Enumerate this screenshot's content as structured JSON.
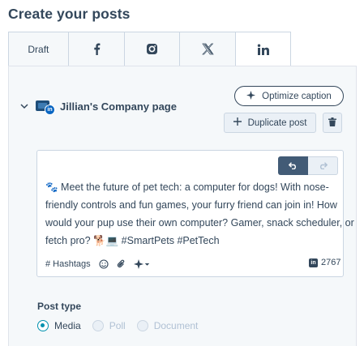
{
  "page": {
    "title": "Create your posts"
  },
  "tabs": [
    {
      "label": "Draft",
      "icon": ""
    },
    {
      "label": "",
      "icon": "facebook-icon"
    },
    {
      "label": "",
      "icon": "instagram-icon"
    },
    {
      "label": "",
      "icon": "x-icon"
    },
    {
      "label": "",
      "icon": "linkedin-icon",
      "active": true
    }
  ],
  "account": {
    "name": "Jillian's Company page",
    "badge": "in"
  },
  "actions": {
    "optimize_label": "Optimize caption",
    "duplicate_label": "Duplicate post"
  },
  "post": {
    "text_lines": [
      "🐾 Meet the future of pet tech: a computer for dogs! With nose-",
      "friendly controls and fun games, your furry friend can join in! How",
      "would your pup use their own computer? Gamer, snack scheduler, or",
      "fetch pro? 🐕💻 #SmartPets #PetTech"
    ],
    "char_count": "2767"
  },
  "toolbar": {
    "hashtags_label": "# Hashtags",
    "li_badge": "in"
  },
  "post_type": {
    "label": "Post type",
    "options": [
      {
        "label": "Media",
        "checked": true
      },
      {
        "label": "Poll",
        "checked": false
      },
      {
        "label": "Document",
        "checked": false
      }
    ]
  },
  "colors": {
    "text": "#33475b",
    "accent": "#0091ae",
    "undo_bg": "#425b76",
    "linkedin": "#0a66c2"
  }
}
